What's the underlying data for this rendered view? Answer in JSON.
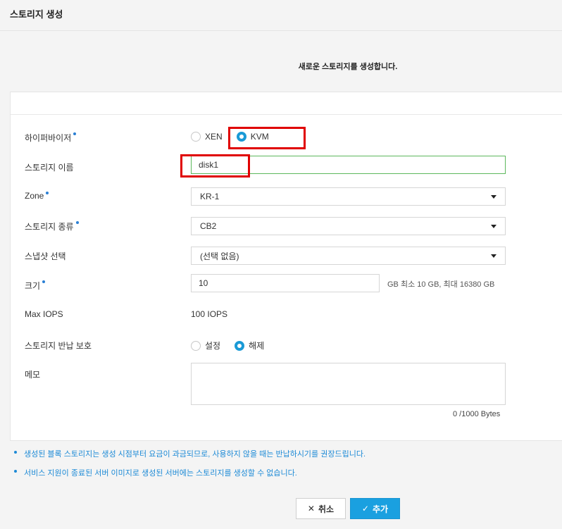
{
  "header": {
    "title": "스토리지 생성"
  },
  "subtitle": "새로운 스토리지를 생성합니다.",
  "form": {
    "hypervisor": {
      "label": "하이퍼바이저",
      "required": true,
      "options": [
        "XEN",
        "KVM"
      ],
      "selected": "KVM"
    },
    "storage_name": {
      "label": "스토리지 이름",
      "value": "disk1"
    },
    "zone": {
      "label": "Zone",
      "required": true,
      "value": "KR-1"
    },
    "storage_type": {
      "label": "스토리지 종류",
      "required": true,
      "value": "CB2"
    },
    "snapshot": {
      "label": "스냅샷 선택",
      "value": "(선택 없음)"
    },
    "size": {
      "label": "크기",
      "required": true,
      "value": "10",
      "hint": "GB  최소 10 GB, 최대 16380 GB"
    },
    "max_iops": {
      "label": "Max IOPS",
      "value": "100 IOPS"
    },
    "protection": {
      "label": "스토리지 반납 보호",
      "options": [
        "설정",
        "해제"
      ],
      "selected": "해제"
    },
    "memo": {
      "label": "메모",
      "value": "",
      "counter": "0 /1000 Bytes"
    }
  },
  "notes": [
    "생성된 블록 스토리지는 생성 시점부터 요금이 과금되므로, 사용하지 않을 때는 반납하시기를 권장드립니다.",
    "서비스 지원이 종료된 서버 이미지로 생성된 서버에는 스토리지를 생성할 수 없습니다."
  ],
  "buttons": {
    "cancel": "취소",
    "add": "추가"
  },
  "colors": {
    "accent": "#1aa0e0",
    "required_dot": "#2a7fd4",
    "note_text": "#1d8ad6",
    "highlight": "#e00000"
  },
  "icons": {
    "cancel": "close-icon",
    "add": "check-icon"
  }
}
